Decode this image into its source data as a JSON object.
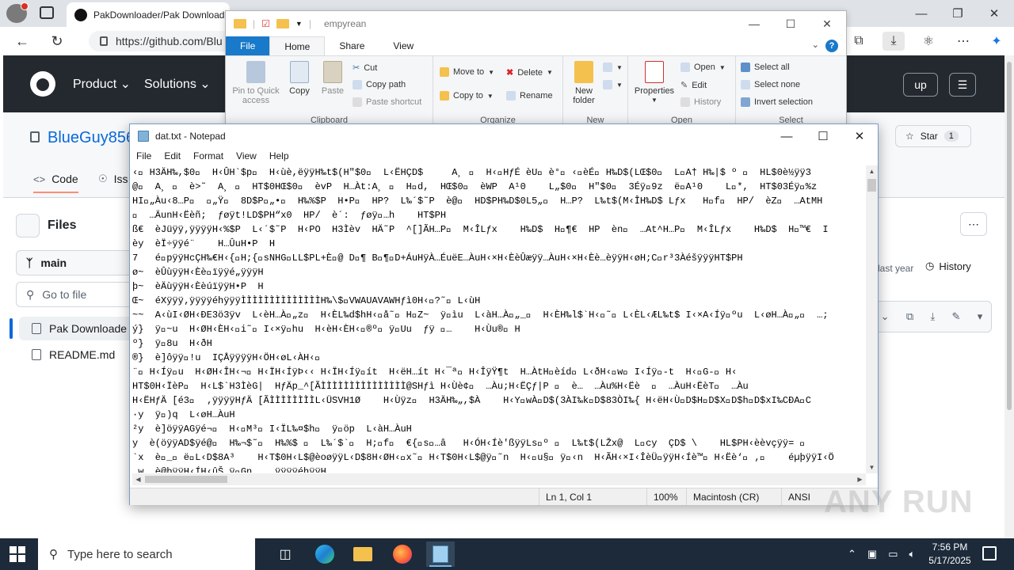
{
  "browser": {
    "tab_title": "PakDownloader/Pak Download",
    "url": "https://github.com/Blu",
    "minimize": "—",
    "restore": "❐",
    "close": "✕"
  },
  "github": {
    "nav": [
      "Product",
      "Solutions"
    ],
    "signup": "up",
    "repo_owner": "BlueGuy856",
    "star_label": "Star",
    "star_count": "1",
    "tabs": [
      {
        "label": "Code"
      },
      {
        "label": "Iss"
      }
    ],
    "files_title": "Files",
    "branch": "main",
    "goto_placeholder": "Go to file",
    "files": [
      "Pak Downloade",
      "README.md"
    ],
    "last_updated": "last year",
    "history": "History"
  },
  "explorer": {
    "title": "empyrean",
    "tabs": {
      "file": "File",
      "home": "Home",
      "share": "Share",
      "view": "View"
    },
    "clipboard": {
      "pin": "Pin to Quick access",
      "copy": "Copy",
      "paste": "Paste",
      "cut": "Cut",
      "copy_path": "Copy path",
      "paste_shortcut": "Paste shortcut",
      "label": "Clipboard"
    },
    "organize": {
      "move_to": "Move to",
      "copy_to": "Copy to",
      "delete": "Delete",
      "rename": "Rename",
      "label": "Organize"
    },
    "new": {
      "new_folder": "New folder",
      "label": "New"
    },
    "open": {
      "properties": "Properties",
      "open": "Open",
      "edit": "Edit",
      "history": "History",
      "label": "Open"
    },
    "select": {
      "select_all": "Select all",
      "select_none": "Select none",
      "invert": "Invert selection",
      "label": "Select"
    }
  },
  "notepad": {
    "title": "dat.txt - Notepad",
    "menu": [
      "File",
      "Edit",
      "Format",
      "View",
      "Help"
    ],
    "lines": [
      "‹\u0000 H3ÄH‰,$0\u0000  H‹ÛH`$p\u0000  H‹ùè,ëÿÿH‰t$(H\"$0\u0000  L‹ËHÇD$     A¸ \u0000  H‹\u0000HƒÉ èU\u0000 è°\u0000 ‹\u0000èÉ\u0000 H‰D$(LŒ$0\u0000  L\u0000A† H‰|$ º \u0000  HL$0è½ÿÿ3",
      "@\u0000  A¸ \u0000  è>˜  A¸ \u0000  HT$0HŒ$0\u0000  èvP  H…Àt:A¸ \u0000  H\u0000d,  HŒ$0\u0000  èWP  A¹0    L„$0\u0000  H\"$0\u0000  3Éÿ\u00009z  ë\u0000A¹0    L\u0000*,  HT$03Éÿ\u0000%z",
      "HI\u0000„Àu‹8…P\u0000  \u0000„Ÿ\u0000  8D$P\u0000„•\u0000  H‰%$P  H•P\u0000  HP?  L‰´$˜P  è@\u0000  HD$PH‰D$0L5„\u0000  H…P?  L‰t$(M‹ÎH‰D$ Lƒx   H\u0000f\u0000  HP/  èZ\u0000  …AtMH",
      "\u0000  …ÄunH‹Ëèñ;  ƒøÿt!LD$PH“x0  HP/  è´:  ƒøÿ\u0000…h    HT$PH",
      "ß€  èJüÿÿ‚ÿÿÿÿH‹%$P  L‹´$˜P  H‹PO  H3Ìèv  HÄ˜P  ^[]ÃH…P\u0000  M‹ÎLƒx    H‰D$  H\u0000¶€  HP  èn\u0000  …At^H…P\u0000  M‹ÎLƒx    H‰D$  H\u0000™€  I",
      "èy  èÏ÷ÿÿé¨    H…ÛuH•P  H",
      "7   é\u0000pÿÿHcÇH‰€H‹{\u0000H;{\u0000sNHG\u0000LL$PL+È\u0000@ D\u0000¶ B\u0000¶\u0000D+ÁuHÿÀ…ÉuëE…ÀuH‹×H‹ÈèÛæÿÿ…ÀuH‹×H‹Èè…èÿÿH‹øH;C\u0000r³3ÀéšÿÿÿHT$PH",
      "ø~  èÛùÿÿH‹Èè\u0000ïÿÿé„ÿÿÿH",
      "þ~  èÄùÿÿH‹ÈèúïÿÿH•P  H",
      "Œ~  éXÿÿÿ‚ÿÿÿÿéhÿÿÿÌÌÌÌÌÌÌÌÌÌÌÌÌÌH‰\\$\u0000VWAUAVAWHƒì0H‹\u0000?˜\u0000 L‹ùH",
      "~~  A‹ùI‹ØH‹ÐE3ö3ÿv  L‹èH…À\u0000„z\u0000  H‹ÈL‰d$hH‹\u0000å˜\u0000 H\u0000Z~  ÿ\u0000ìu  L‹àH…À\u0000„_\u0000  H‹ÈH‰l$`H‹\u0000˜\u0000 L‹ÈL‹ÆL‰t$ I‹×A‹Íÿ\u0000ºu  L‹øH…À\u0000„\u0000  …;",
      "ý}  ÿ\u0000~u  H‹ØH‹ÈH‹\u0000i˜\u0000 I‹×ÿ\u0000hu  H‹èH‹ÈH‹\u0000®º\u0000 ÿ\u0000Uu  ƒÿ \u0000…    H‹Ùu®\u0000 H",
      "º}  ÿ\u00008u  H‹ðH",
      "®}  è]ôÿÿ\u0000!u  IÇÅÿÿÿÿH‹ÖH‹øL‹ÀH‹\u0000",
      "¨\u0000 H‹Íÿ\u0000u  H‹ØH‹ÎH‹¬\u0000 H‹ÏH‹ÍÿÞ‹‹ H‹ÏH‹Íÿ\u0000ít  H‹ëH…ít H‹¯ª\u0000 H‹ÎÿŸ¶t  H…ÀtH\u0000èíd\u0000 L‹ðH‹\u0000w\u0000 I‹Íÿ\u0000-t  H‹\u0000G-\u0000 H‹",
      "HT$0H‹ÏèP\u0000  H‹L$`H3ÌèG|  HƒÄp_^[ÃÌÌÌÌÌÌÌÌÌÌÌÌÌÌÌ@SHƒì H‹Ùè¢\u0000  …Àu;H‹ËÇƒ|P \u0000  è…  …Àu%H‹Ëè  \u0000  …ÀuH‹ËèT\u0000  …Àu",
      "H‹ËHƒÄ [é3\u0000  ‚ÿÿÿÿHƒÄ [ÃÌÌÌÌÌÌÌÌL‹ÜSVH1Ø    H‹Ùÿz\u0000  H3ÄH‰„,$À    H‹Y\u0000wÀ\u0000D$(3ÀI‰k\u0000D$83ÒI‰{ H‹ëH‹Ù\u0000D$H\u0000D$X\u0000D$h\u0000D$xI‰CÐA\u0000C",
      "·y  ÿ\u0000)q  L‹øH…ÀuH",
      "²y  è]öÿÿAGÿé¬\u0000  H‹\u0000M³\u0000 I‹ÏL‰¤$h\u0000  ÿ\u0000öp  L‹àH…ÀuH",
      "y  è(öÿÿAD$ÿé@\u0000  H‰¬$˜\u0000  H‰%$ \u0000  L‰´$`\u0000  H;\u0000f\u0000  €{\u0000s\u0000…â   H‹ÓH‹Íè'ßÿÿLs\u0000º \u0000  L‰t$(LŽx@  L\u0000cy  ÇD$ \\    HL$PH‹èèvçÿÿ= \u0000",
      "`x  è\u0000_\u0000 ë\u0000L‹D$8A³    H‹T$0H‹L$@èoøÿÿL‹D$8H‹ØH‹\u0000x˜\u0000 H‹T$0H‹L$@ÿ\u0000˜n  H‹\u0000u§\u0000 ÿ\u0000‹n  H‹ÃH‹×I‹ÎèÜ\u0000ÿÿH‹Íè™\u0000 H‹Ëè‘\u0000 ‚\u0000    éµþÿÿI‹Ö",
      "…w  è@þÿÿH‹ÍH‹ûŠ ÿ\u0000Gn    ÿÿÿÿéhÿÿH"
    ],
    "status": {
      "position": "Ln 1, Col 1",
      "zoom": "100%",
      "eol": "Macintosh (CR)",
      "encoding": "ANSI"
    }
  },
  "taskbar": {
    "search_placeholder": "Type here to search",
    "time": "7:56 PM",
    "date": "5/17/2025"
  },
  "watermark": "ANY RUN"
}
